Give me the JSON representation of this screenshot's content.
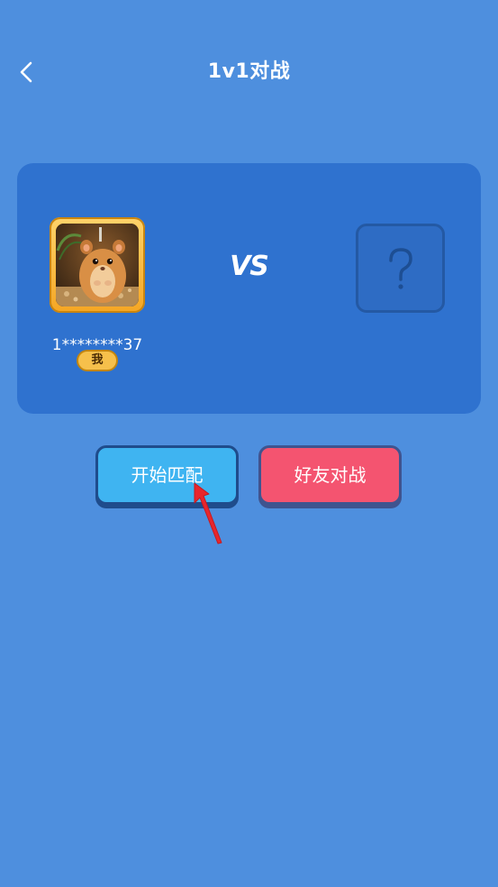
{
  "header": {
    "title": "1v1对战",
    "back_icon": "chevron-left-icon"
  },
  "player": {
    "username": "1********37",
    "badge": "我"
  },
  "vs_label": "VS",
  "opponent": {
    "placeholder_icon": "question-mark-icon"
  },
  "buttons": {
    "start_match": "开始匹配",
    "friend_battle": "好友对战"
  },
  "colors": {
    "background": "#4e8fde",
    "card": "#2f72cf",
    "start_match": "#3fb4f1",
    "friend_battle": "#f45470",
    "avatar_frame": "#f5a623"
  }
}
